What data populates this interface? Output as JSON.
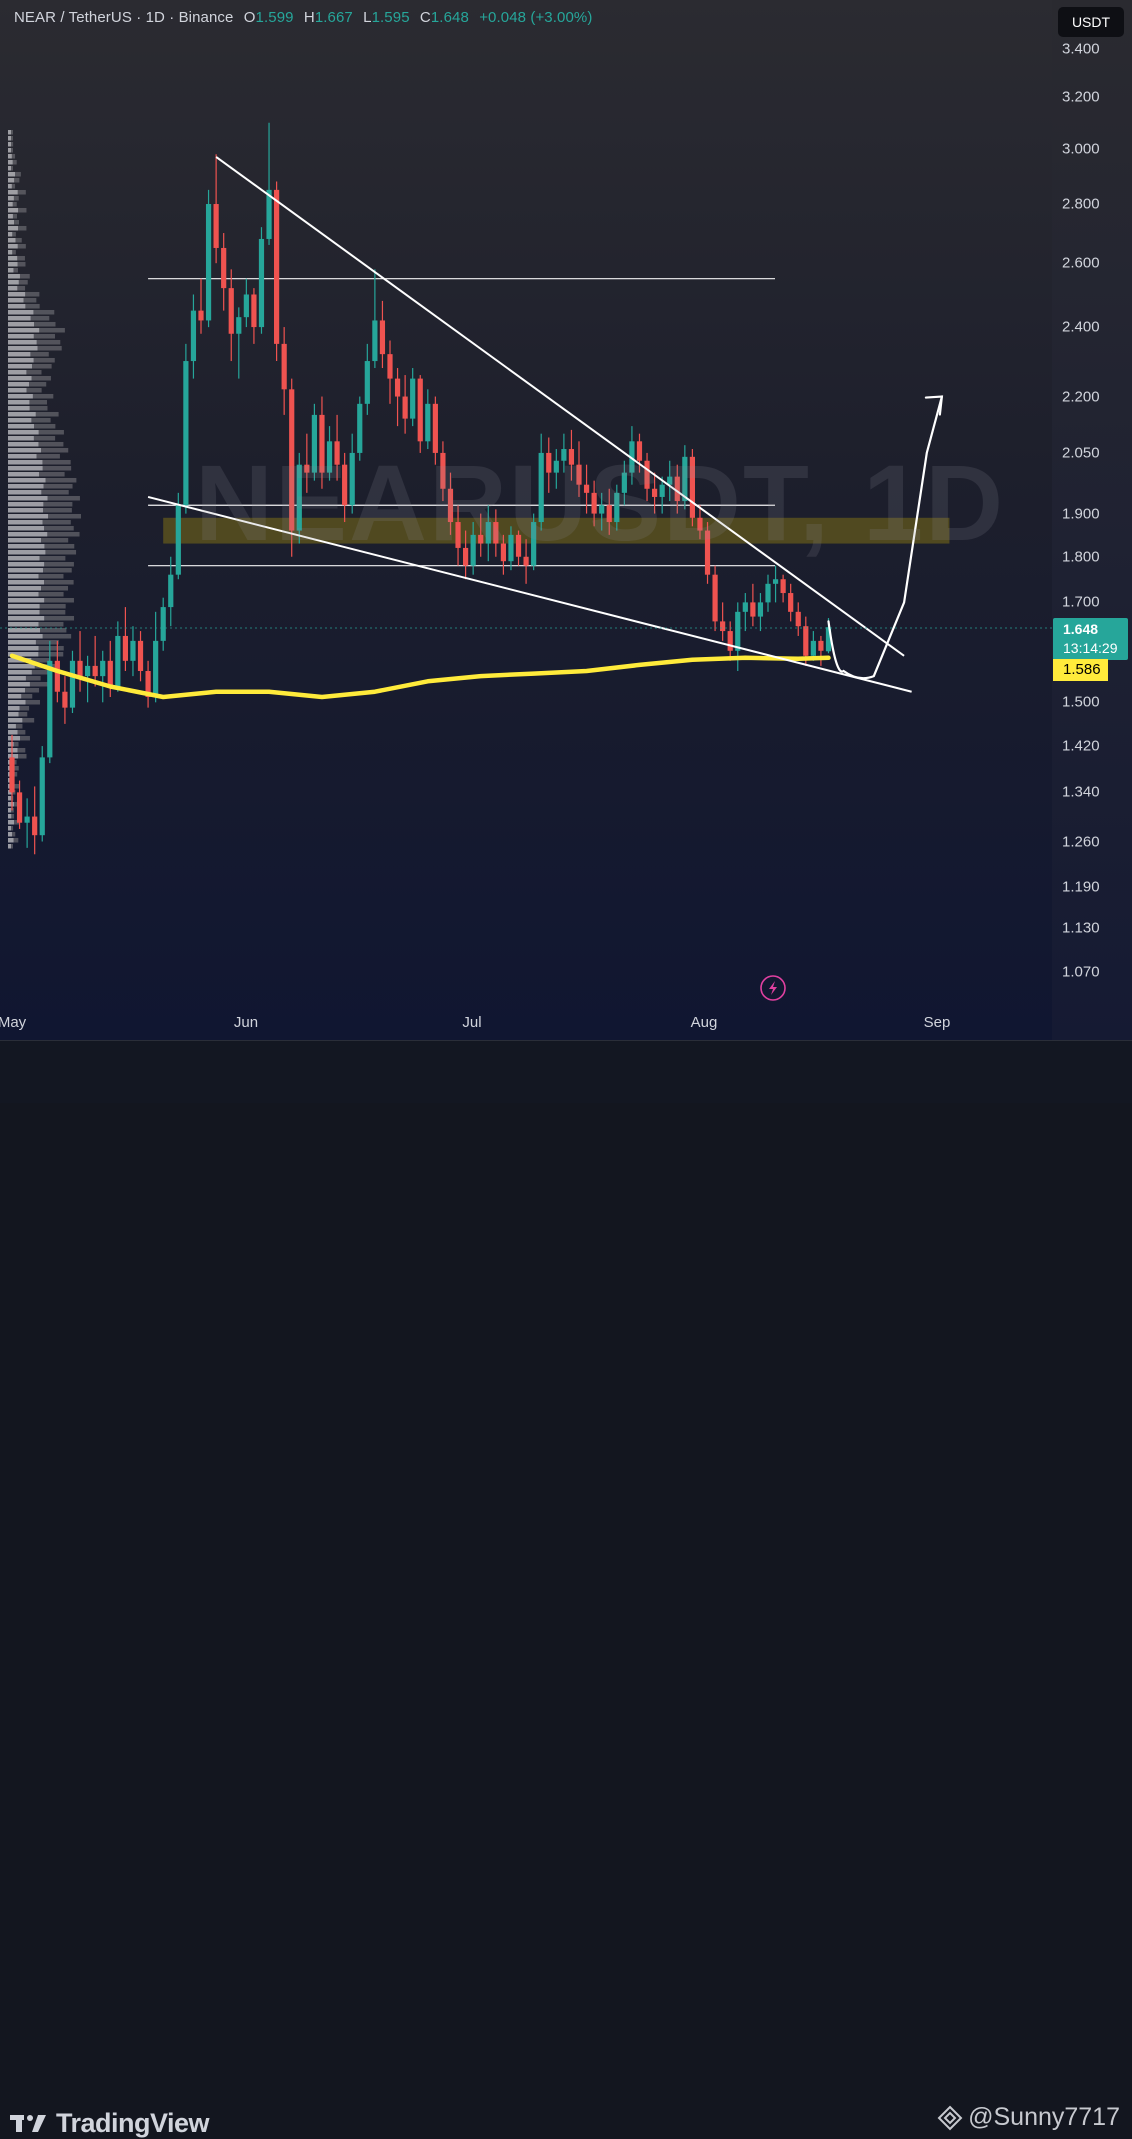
{
  "header": {
    "symbol": "NEAR / TetherUS · 1D · Binance",
    "o_label": "O",
    "o_value": "1.599",
    "h_label": "H",
    "h_value": "1.667",
    "l_label": "L",
    "l_value": "1.595",
    "c_label": "C",
    "c_value": "1.648",
    "change": "+0.048 (+3.00%)"
  },
  "watermark": "NEARUSDT, 1D",
  "currency_button": "USDT",
  "price_scale": {
    "ticks": [
      "3.400",
      "3.200",
      "3.000",
      "2.800",
      "2.600",
      "2.400",
      "2.200",
      "2.050",
      "1.900",
      "1.800",
      "1.700",
      "1.500",
      "1.420",
      "1.340",
      "1.260",
      "1.190",
      "1.130",
      "1.070"
    ],
    "last_price": "1.648",
    "countdown": "13:14:29",
    "ma_value": "1.586"
  },
  "time_axis": {
    "labels": [
      "May",
      "Jun",
      "Jul",
      "Aug",
      "Sep"
    ]
  },
  "footer": {
    "brand": "TradingView",
    "author": "@Sunny7717"
  },
  "colors": {
    "up": "#26a69a",
    "down": "#ef5350",
    "ma": "#ffeb3b",
    "lines": "#ffffff",
    "zone": "#59511f",
    "last_price_bg": "#26a69a"
  },
  "chart_data": {
    "type": "candlestick",
    "scale": "log",
    "ylim": [
      1.03,
      3.5
    ],
    "x_start": "2024-05-01",
    "x_end": "2024-09-30",
    "candles": [
      [
        "2024-05-01",
        1.4,
        1.44,
        1.31,
        1.34
      ],
      [
        "2024-05-02",
        1.34,
        1.36,
        1.28,
        1.29
      ],
      [
        "2024-05-03",
        1.29,
        1.33,
        1.25,
        1.3
      ],
      [
        "2024-05-04",
        1.3,
        1.35,
        1.24,
        1.27
      ],
      [
        "2024-05-05",
        1.27,
        1.42,
        1.26,
        1.4
      ],
      [
        "2024-05-06",
        1.4,
        1.62,
        1.39,
        1.58
      ],
      [
        "2024-05-07",
        1.58,
        1.62,
        1.5,
        1.52
      ],
      [
        "2024-05-08",
        1.52,
        1.55,
        1.46,
        1.49
      ],
      [
        "2024-05-09",
        1.49,
        1.6,
        1.48,
        1.58
      ],
      [
        "2024-05-10",
        1.58,
        1.64,
        1.52,
        1.55
      ],
      [
        "2024-05-11",
        1.55,
        1.59,
        1.5,
        1.57
      ],
      [
        "2024-05-12",
        1.57,
        1.63,
        1.53,
        1.55
      ],
      [
        "2024-05-13",
        1.55,
        1.6,
        1.5,
        1.58
      ],
      [
        "2024-05-14",
        1.58,
        1.62,
        1.51,
        1.53
      ],
      [
        "2024-05-15",
        1.53,
        1.66,
        1.52,
        1.63
      ],
      [
        "2024-05-16",
        1.63,
        1.69,
        1.56,
        1.58
      ],
      [
        "2024-05-17",
        1.58,
        1.65,
        1.55,
        1.62
      ],
      [
        "2024-05-18",
        1.62,
        1.64,
        1.54,
        1.56
      ],
      [
        "2024-05-19",
        1.56,
        1.58,
        1.49,
        1.51
      ],
      [
        "2024-05-20",
        1.51,
        1.68,
        1.5,
        1.62
      ],
      [
        "2024-05-21",
        1.62,
        1.71,
        1.6,
        1.69
      ],
      [
        "2024-05-22",
        1.69,
        1.8,
        1.65,
        1.76
      ],
      [
        "2024-05-23",
        1.76,
        1.95,
        1.75,
        1.92
      ],
      [
        "2024-05-24",
        1.92,
        2.35,
        1.9,
        2.3
      ],
      [
        "2024-05-25",
        2.3,
        2.5,
        2.25,
        2.45
      ],
      [
        "2024-05-26",
        2.45,
        2.55,
        2.38,
        2.42
      ],
      [
        "2024-05-27",
        2.42,
        2.85,
        2.4,
        2.8
      ],
      [
        "2024-05-28",
        2.8,
        2.98,
        2.6,
        2.65
      ],
      [
        "2024-05-29",
        2.65,
        2.7,
        2.45,
        2.52
      ],
      [
        "2024-05-30",
        2.52,
        2.58,
        2.3,
        2.38
      ],
      [
        "2024-05-31",
        2.38,
        2.46,
        2.25,
        2.43
      ],
      [
        "2024-06-01",
        2.43,
        2.55,
        2.4,
        2.5
      ],
      [
        "2024-06-02",
        2.5,
        2.52,
        2.35,
        2.4
      ],
      [
        "2024-06-03",
        2.4,
        2.72,
        2.38,
        2.68
      ],
      [
        "2024-06-04",
        2.68,
        3.1,
        2.66,
        2.85
      ],
      [
        "2024-06-05",
        2.85,
        2.88,
        2.3,
        2.35
      ],
      [
        "2024-06-06",
        2.35,
        2.4,
        2.15,
        2.22
      ],
      [
        "2024-06-07",
        2.22,
        2.25,
        1.8,
        1.86
      ],
      [
        "2024-06-08",
        1.86,
        2.05,
        1.83,
        2.02
      ],
      [
        "2024-06-09",
        2.02,
        2.1,
        1.95,
        2.0
      ],
      [
        "2024-06-10",
        2.0,
        2.18,
        1.98,
        2.15
      ],
      [
        "2024-06-11",
        2.15,
        2.2,
        1.96,
        2.0
      ],
      [
        "2024-06-12",
        2.0,
        2.12,
        1.98,
        2.08
      ],
      [
        "2024-06-13",
        2.08,
        2.15,
        1.98,
        2.02
      ],
      [
        "2024-06-14",
        2.02,
        2.05,
        1.88,
        1.92
      ],
      [
        "2024-06-15",
        1.92,
        2.1,
        1.9,
        2.05
      ],
      [
        "2024-06-16",
        2.05,
        2.2,
        2.03,
        2.18
      ],
      [
        "2024-06-17",
        2.18,
        2.35,
        2.15,
        2.3
      ],
      [
        "2024-06-18",
        2.3,
        2.58,
        2.28,
        2.42
      ],
      [
        "2024-06-19",
        2.42,
        2.48,
        2.28,
        2.32
      ],
      [
        "2024-06-20",
        2.32,
        2.36,
        2.18,
        2.25
      ],
      [
        "2024-06-21",
        2.25,
        2.28,
        2.12,
        2.2
      ],
      [
        "2024-06-22",
        2.2,
        2.26,
        2.1,
        2.14
      ],
      [
        "2024-06-23",
        2.14,
        2.28,
        2.12,
        2.25
      ],
      [
        "2024-06-24",
        2.25,
        2.26,
        2.05,
        2.08
      ],
      [
        "2024-06-25",
        2.08,
        2.22,
        2.06,
        2.18
      ],
      [
        "2024-06-26",
        2.18,
        2.2,
        2.02,
        2.05
      ],
      [
        "2024-06-27",
        2.05,
        2.08,
        1.93,
        1.96
      ],
      [
        "2024-06-28",
        1.96,
        2.0,
        1.85,
        1.88
      ],
      [
        "2024-06-29",
        1.88,
        1.92,
        1.78,
        1.82
      ],
      [
        "2024-06-30",
        1.82,
        1.86,
        1.75,
        1.78
      ],
      [
        "2024-07-01",
        1.78,
        1.88,
        1.76,
        1.85
      ],
      [
        "2024-07-02",
        1.85,
        1.9,
        1.8,
        1.83
      ],
      [
        "2024-07-03",
        1.83,
        1.92,
        1.79,
        1.88
      ],
      [
        "2024-07-04",
        1.88,
        1.91,
        1.8,
        1.83
      ],
      [
        "2024-07-05",
        1.83,
        1.85,
        1.76,
        1.79
      ],
      [
        "2024-07-06",
        1.79,
        1.87,
        1.77,
        1.85
      ],
      [
        "2024-07-07",
        1.85,
        1.86,
        1.78,
        1.8
      ],
      [
        "2024-07-08",
        1.8,
        1.84,
        1.74,
        1.78
      ],
      [
        "2024-07-09",
        1.78,
        1.9,
        1.77,
        1.88
      ],
      [
        "2024-07-10",
        1.88,
        2.1,
        1.86,
        2.05
      ],
      [
        "2024-07-11",
        2.05,
        2.09,
        1.95,
        2.0
      ],
      [
        "2024-07-12",
        2.0,
        2.06,
        1.96,
        2.03
      ],
      [
        "2024-07-13",
        2.03,
        2.1,
        2.0,
        2.06
      ],
      [
        "2024-07-14",
        2.06,
        2.11,
        1.98,
        2.02
      ],
      [
        "2024-07-15",
        2.02,
        2.08,
        1.94,
        1.97
      ],
      [
        "2024-07-16",
        1.97,
        2.02,
        1.9,
        1.95
      ],
      [
        "2024-07-17",
        1.95,
        1.98,
        1.87,
        1.9
      ],
      [
        "2024-07-18",
        1.9,
        1.95,
        1.86,
        1.92
      ],
      [
        "2024-07-19",
        1.92,
        1.96,
        1.85,
        1.88
      ],
      [
        "2024-07-20",
        1.88,
        1.97,
        1.86,
        1.95
      ],
      [
        "2024-07-21",
        1.95,
        2.03,
        1.92,
        2.0
      ],
      [
        "2024-07-22",
        2.0,
        2.12,
        1.97,
        2.08
      ],
      [
        "2024-07-23",
        2.08,
        2.1,
        2.0,
        2.03
      ],
      [
        "2024-07-24",
        2.03,
        2.05,
        1.93,
        1.96
      ],
      [
        "2024-07-25",
        1.96,
        2.0,
        1.9,
        1.94
      ],
      [
        "2024-07-26",
        1.94,
        1.99,
        1.9,
        1.97
      ],
      [
        "2024-07-27",
        1.97,
        2.03,
        1.93,
        1.99
      ],
      [
        "2024-07-28",
        1.99,
        2.02,
        1.9,
        1.93
      ],
      [
        "2024-07-29",
        1.93,
        2.07,
        1.91,
        2.04
      ],
      [
        "2024-07-30",
        2.04,
        2.06,
        1.87,
        1.89
      ],
      [
        "2024-07-31",
        1.89,
        1.92,
        1.84,
        1.86
      ],
      [
        "2024-08-01",
        1.86,
        1.88,
        1.74,
        1.76
      ],
      [
        "2024-08-02",
        1.76,
        1.78,
        1.64,
        1.66
      ],
      [
        "2024-08-03",
        1.66,
        1.7,
        1.62,
        1.64
      ],
      [
        "2024-08-04",
        1.64,
        1.66,
        1.58,
        1.6
      ],
      [
        "2024-08-05",
        1.6,
        1.7,
        1.56,
        1.68
      ],
      [
        "2024-08-06",
        1.68,
        1.72,
        1.64,
        1.7
      ],
      [
        "2024-08-07",
        1.7,
        1.74,
        1.65,
        1.67
      ],
      [
        "2024-08-08",
        1.67,
        1.72,
        1.64,
        1.7
      ],
      [
        "2024-08-09",
        1.7,
        1.76,
        1.68,
        1.74
      ],
      [
        "2024-08-10",
        1.74,
        1.78,
        1.7,
        1.75
      ],
      [
        "2024-08-11",
        1.75,
        1.76,
        1.7,
        1.72
      ],
      [
        "2024-08-12",
        1.72,
        1.74,
        1.66,
        1.68
      ],
      [
        "2024-08-13",
        1.68,
        1.7,
        1.63,
        1.65
      ],
      [
        "2024-08-14",
        1.65,
        1.67,
        1.57,
        1.59
      ],
      [
        "2024-08-15",
        1.59,
        1.64,
        1.58,
        1.62
      ],
      [
        "2024-08-16",
        1.62,
        1.63,
        1.57,
        1.6
      ],
      [
        "2024-08-17",
        1.599,
        1.667,
        1.595,
        1.648
      ]
    ],
    "moving_average": [
      [
        "2024-05-01",
        1.59
      ],
      [
        "2024-05-07",
        1.56
      ],
      [
        "2024-05-14",
        1.53
      ],
      [
        "2024-05-21",
        1.51
      ],
      [
        "2024-05-28",
        1.52
      ],
      [
        "2024-06-04",
        1.52
      ],
      [
        "2024-06-11",
        1.51
      ],
      [
        "2024-06-18",
        1.52
      ],
      [
        "2024-06-25",
        1.54
      ],
      [
        "2024-07-02",
        1.55
      ],
      [
        "2024-07-09",
        1.555
      ],
      [
        "2024-07-16",
        1.56
      ],
      [
        "2024-07-23",
        1.572
      ],
      [
        "2024-07-30",
        1.582
      ],
      [
        "2024-08-06",
        1.586
      ],
      [
        "2024-08-13",
        1.584
      ],
      [
        "2024-08-17",
        1.586
      ]
    ],
    "horizontal_levels": [
      2.55,
      1.92,
      1.78
    ],
    "zone": {
      "from": "2024-05-21",
      "to": "2024-09-02",
      "low": 1.83,
      "high": 1.89
    },
    "trendlines": [
      {
        "name": "descending resistance",
        "from": [
          "2024-05-28",
          2.97
        ],
        "to": [
          "2024-08-27",
          1.59
        ]
      },
      {
        "name": "descending support",
        "from": [
          "2024-05-19",
          1.94
        ],
        "to": [
          "2024-08-28",
          1.52
        ]
      }
    ],
    "projection_path": [
      [
        "2024-08-17",
        1.66
      ],
      [
        "2024-08-19",
        1.56
      ],
      [
        "2024-08-23",
        1.55
      ],
      [
        "2024-08-27",
        1.7
      ],
      [
        "2024-08-30",
        2.05
      ],
      [
        "2024-09-01",
        2.2
      ]
    ]
  }
}
